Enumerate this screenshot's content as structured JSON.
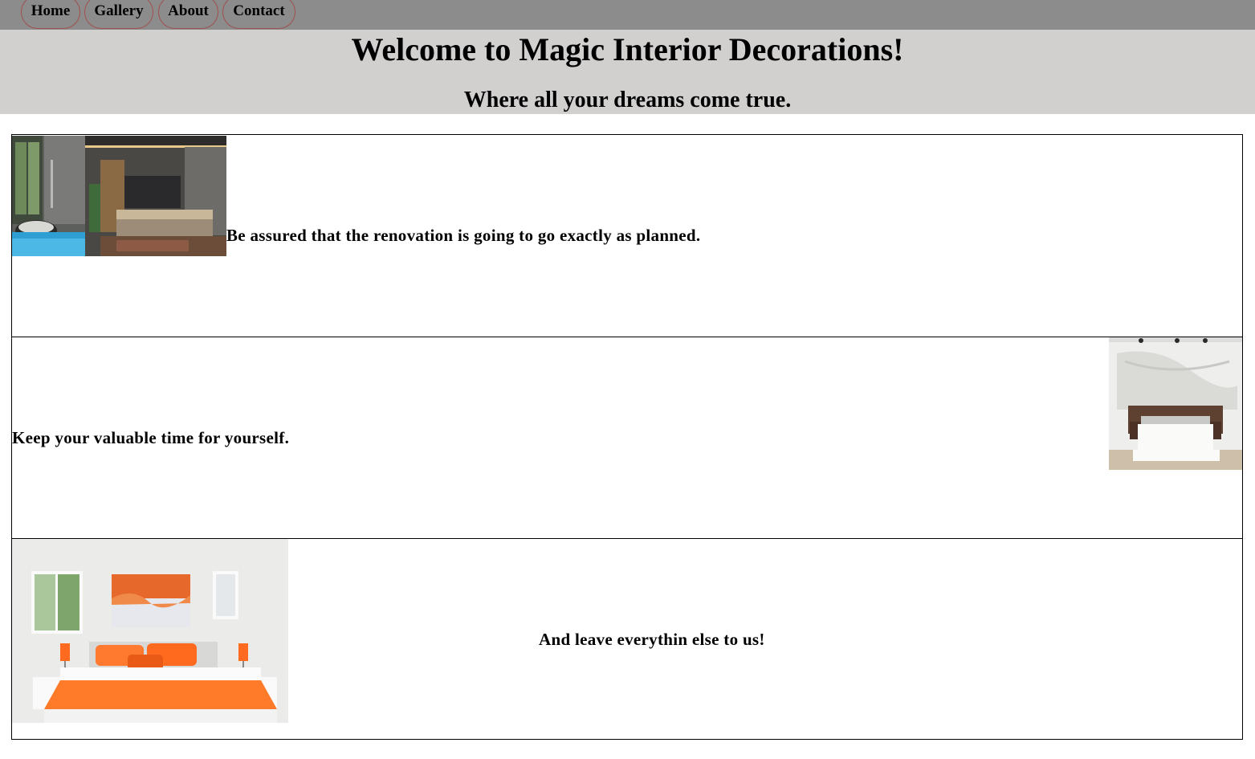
{
  "nav": {
    "items": [
      {
        "label": "Home"
      },
      {
        "label": "Gallery"
      },
      {
        "label": "About"
      },
      {
        "label": "Contact"
      }
    ]
  },
  "header": {
    "title": "Welcome to Magic Interior Decorations!",
    "subtitle": "Where all your dreams come true."
  },
  "sections": [
    {
      "text": "Be assured that the renovation is going to go exactly as planned.",
      "image": "modern-bedroom-with-bath-photo"
    },
    {
      "text": "Keep your valuable time for yourself.",
      "image": "white-bedroom-photo"
    },
    {
      "text": "And leave everythin else to us!",
      "image": "orange-bedroom-photo"
    }
  ],
  "colors": {
    "navbar_bg": "#8c8c8c",
    "header_bg": "#d2cfcf",
    "nav_border": "#a05050"
  }
}
